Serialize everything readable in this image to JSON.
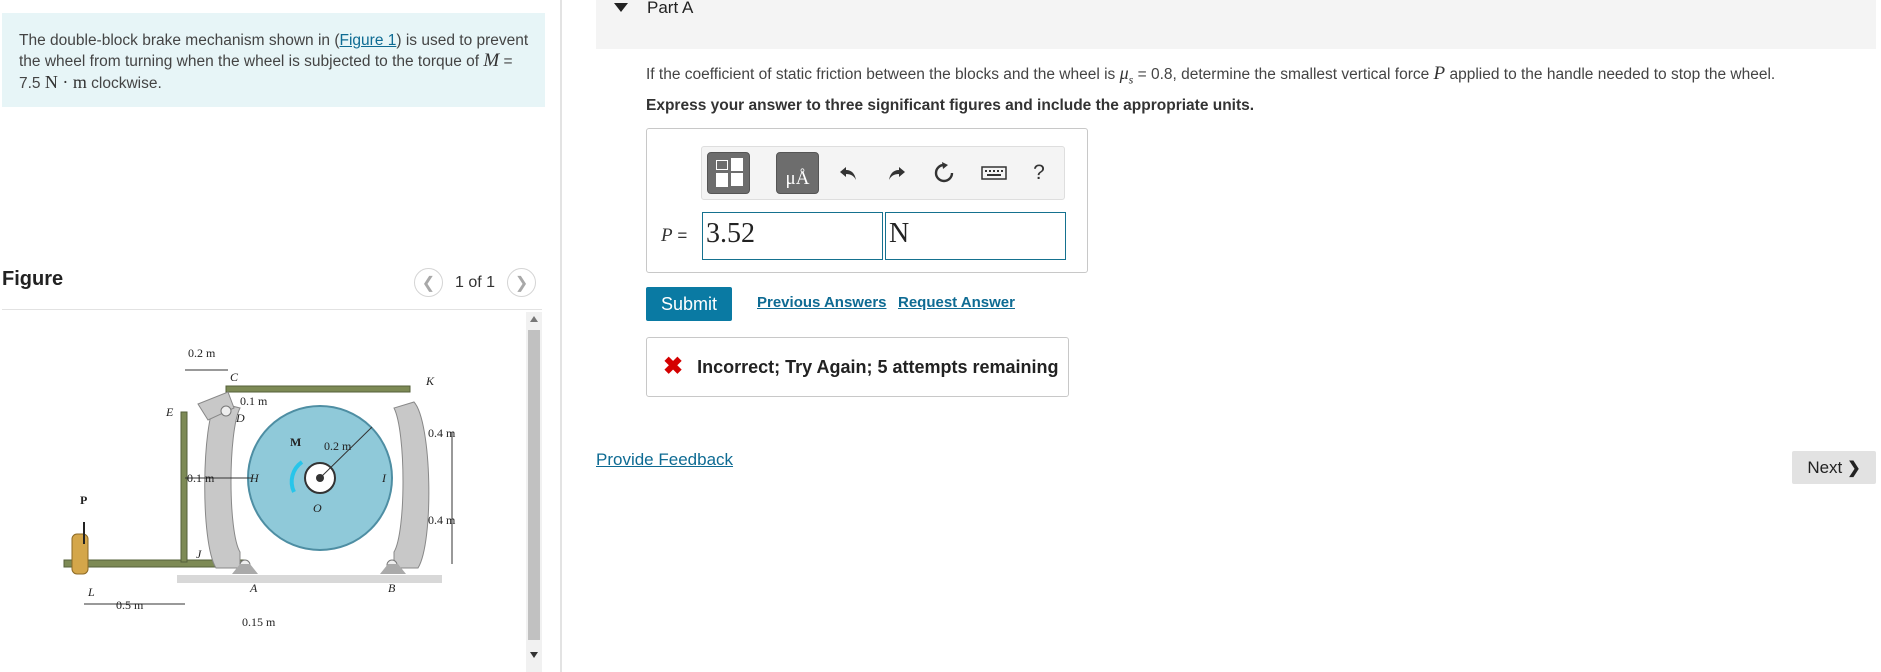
{
  "problem": {
    "text_before_link": "The double-block brake mechanism shown in (",
    "link_text": "Figure 1",
    "text_after_link": ") is used to prevent the wheel from turning when the wheel is subjected to the torque of ",
    "torque_symbol": "M",
    "torque_equals": " = 7.5 ",
    "torque_unit": "N · m",
    "text_end": " clockwise."
  },
  "figure": {
    "label": "Figure",
    "pager_text": "1 of 1",
    "prev_icon": "chevron-left-icon",
    "next_icon": "chevron-right-icon",
    "labels": {
      "dim_top": "0.2 m",
      "C": "C",
      "K": "K",
      "E": "E",
      "D": "D",
      "dim_01_top": "0.1 m",
      "M": "M",
      "dim_02": "0.2 m",
      "dim_04_top": "0.4 m",
      "dim_01_side": "0.1 m",
      "H": "H",
      "I": "I",
      "O": "O",
      "P": "P",
      "dim_04_bottom": "0.4 m",
      "J": "J",
      "L": "L",
      "A": "A",
      "B": "B",
      "dim_05": "0.5 m",
      "dim_015": "0.15 m"
    },
    "colors": {
      "wheel": "#8fc9d9",
      "arm": "#c8c8c8",
      "link": "#7d8a55"
    }
  },
  "part": {
    "title": "Part A",
    "caret_icon": "caret-down-icon",
    "question_before": "If the coefficient of static friction between the blocks and the wheel is ",
    "mu_symbol": "μ",
    "mu_sub": "s",
    "question_mid": " = 0.8, determine the smallest vertical force ",
    "force_symbol": "P",
    "question_after": " applied to the handle needed to stop the wheel.",
    "instructions": "Express your answer to three significant figures and include the appropriate units."
  },
  "toolbar": {
    "templates_icon": "templates-icon",
    "symbols_label": "μÅ",
    "undo_icon": "undo-icon",
    "redo_icon": "redo-icon",
    "reset_icon": "reset-icon",
    "keyboard_icon": "keyboard-icon",
    "help_label": "?"
  },
  "answer": {
    "variable": "P",
    "equals": " =",
    "value": "3.52",
    "unit": "N"
  },
  "actions": {
    "submit_label": "Submit",
    "previous_answers": "Previous Answers",
    "request_answer": "Request Answer"
  },
  "feedback": {
    "icon": "x-icon",
    "text": "Incorrect; Try Again; 5 attempts remaining"
  },
  "footer": {
    "provide_feedback": "Provide Feedback",
    "next_label": "Next"
  }
}
